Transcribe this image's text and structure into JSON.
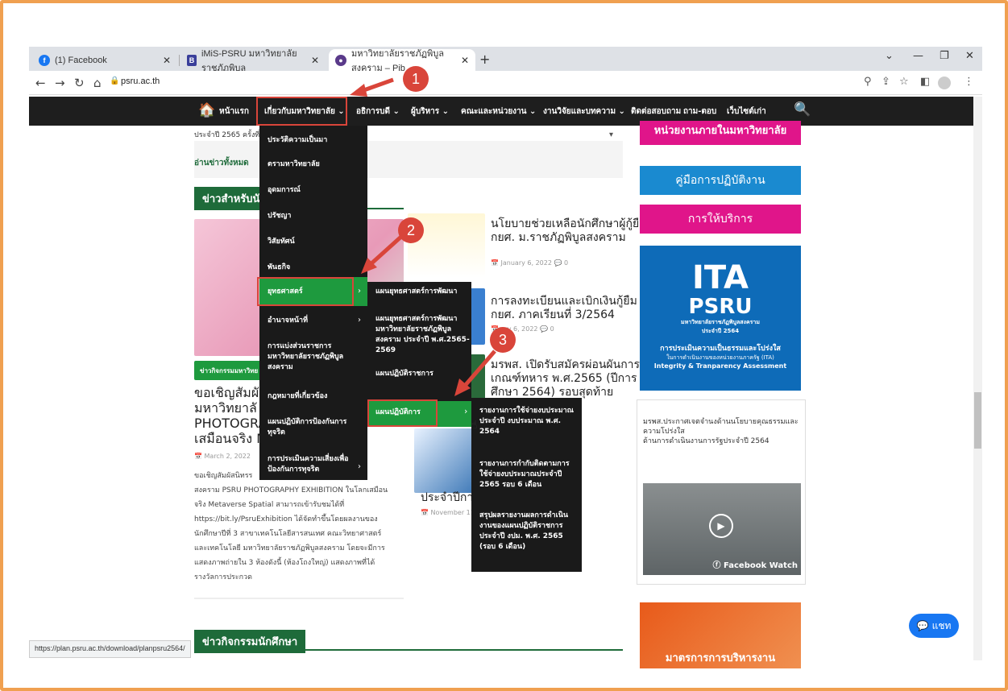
{
  "browser": {
    "tabs": [
      {
        "label": "(1) Facebook",
        "icon": "f"
      },
      {
        "label": "iMiS-PSRU มหาวิทยาลัยราชภัฏพิบูล",
        "icon": "B"
      },
      {
        "label": "มหาวิทยาลัยราชภัฏพิบูลสงคราม – Pib",
        "icon": "●"
      }
    ],
    "new_tab": "+",
    "url": "psru.ac.th",
    "status_url": "https://plan.psru.ac.th/download/planpsru2564/"
  },
  "menu": {
    "home": "หน้าแรก",
    "items": [
      "เกี่ยวกับมหาวิทยาลัย ⌄",
      "อธิการบดี ⌄",
      "ผู้บริหาร ⌄",
      "คณะและหน่วยงาน ⌄",
      "งานวิจัยและบทความ ⌄",
      "ติดต่อสอบถาม",
      "ถาม-ตอบ",
      "เว็บไซต์เก่า"
    ]
  },
  "dropdown": {
    "level1": [
      "ประวัติความเป็นมา",
      "ตรามหาวิทยาลัย",
      "อุดมการณ์",
      "ปรัชญา",
      "วิสัยทัศน์",
      "พันธกิจ",
      "ยุทธศาสตร์",
      "อำนาจหน้าที่",
      "การแบ่งส่วนราชการ มหาวิทยาลัยราชภัฏพิบูลสงคราม",
      "กฎหมายที่เกี่ยวข้อง",
      "แผนปฏิบัติการป้องกันการทุจริต",
      "การประเมินความเสี่ยงเพื่อป้องกันการทุจริต"
    ],
    "level2": [
      "แผนยุทธศาสตร์การพัฒนา",
      "แผนยุทธศาสตร์การพัฒนามหาวิทยาลัยราชภัฏพิบูลสงคราม ประจำปี พ.ศ.2565-2569",
      "แผนปฏิบัติราชการ",
      "แผนปฏิบัติการ"
    ],
    "level3": [
      "รายงานการใช้จ่ายงบประมาณประจำปี งบประมาณ พ.ศ. 2564",
      "รายงานการกำกับติดตามการใช้จ่ายงบประมาณประจำปี 2565 รอบ 6 เดือน",
      "สรุปผลรายงานผลการดำเนินงานของแผนปฏิบัติราชการ ประจำปี งปม. พ.ศ. 2565 (รอบ 6 เดือน)"
    ]
  },
  "steps": [
    "1",
    "2",
    "3"
  ],
  "content": {
    "snippet1": "ประจำปี 2565 ครั้งที่",
    "read_all": "อ่านข่าวทั้งหมด",
    "student_news_heading": "ข่าวสำหรับนักศึ",
    "activity_tag": "ข่าวกิจกรรมมหาวิทย",
    "main_title_lines": [
      "ขอเชิญสัมผั",
      "มหาวิทยาลั",
      "PHOTOGRA",
      "เสมือนจริง M"
    ],
    "main_date": "March 2, 2022",
    "main_body": [
      "ขอเชิญสัมผัสนิทรร",
      "สงคราม PSRU PHOTOGRAPHY EXHIBITION ในโลกเสมือน",
      "จริง Metaverse Spatial สามารถเข้ารับชมได้ที่",
      "https://bit.ly/PsruExhibition ได้จัดทำขึ้นโดยผลงานของ",
      "นักศึกษาปีที่ 3 สาขาเทคโนโลยีสารสนเทศ คณะวิทยาศาสตร์",
      "และเทคโนโลยี มหาวิทยาลัยราชภัฏพิบูลสงคราม โดยจะมีการ",
      "แสดงภาพถ่ายใน 3 ห้องดังนี้ (ห้องโถงใหญ่) แสดงภาพที่ได้",
      "รางวัลการประกวด"
    ],
    "news2_title": [
      "นโยบายช่วยเหลือนักศึกษาผู้กู้ยืม",
      "กยศ. ม.ราชภัฏพิบูลสงคราม"
    ],
    "news2_date": "January 6, 2022",
    "news3_title": [
      "การลงทะเบียนและเบิกเงินกู้ยืม",
      "กยศ. ภาคเรียนที่ 3/2564"
    ],
    "news3_date": "ary 6, 2022",
    "news4_title": [
      "มรพส. เปิดรับสมัครผ่อนผันการ",
      "เกณฑ์ทหาร พ.ศ.2565 (ปีการ",
      "ศึกษา 2564) รอบสุดท้าย"
    ],
    "news5_title": "ประจำปีการศึ",
    "news5_date": "November 11, 20",
    "bottom_heading": "ข่าวกิจกรรมนักศึกษา",
    "right_top_partial": "หน่วยงานภายในมหาวิทยาลัย",
    "manual": "คู่มือการปฏิบัติงาน",
    "service": "การให้บริการ",
    "ita_title": "PSRU",
    "ita_sub": "มหาวิทยาลัยราชภัฏพิบูลสงคราม",
    "ita_year": "ประจำปี 2564",
    "ita_caption": "การประเมินความเป็นธรรมและโปร่งใส",
    "ita_caption2": "ในการดำเนินงานของหน่วยงานภาครัฐ (ITA)",
    "ita_caption3": "Integrity & Tranparency Assessment",
    "announce": [
      "มรพส.ประกาศเจตจำนงด้านนโยบายคุณธรรมและ",
      "ความโปร่งใส",
      "ด้านการดำเนินงานการรัฐประจำปี 2564"
    ],
    "fb_watch": "Facebook Watch",
    "bottom_right_partial": "มาตรการการบริหารงาน",
    "chat": "แชท"
  }
}
